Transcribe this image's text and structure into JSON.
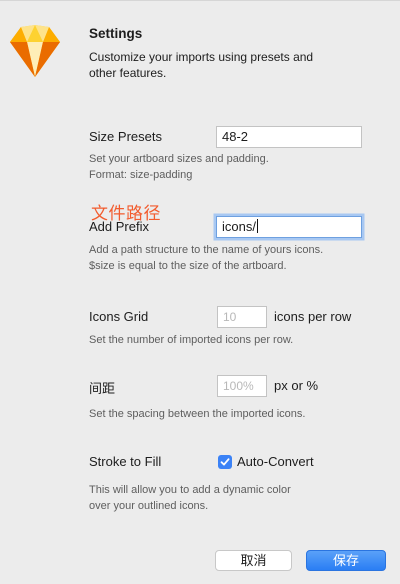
{
  "header": {
    "title": "Settings",
    "subtitle": "Customize your imports using presets and other features."
  },
  "size_presets": {
    "label": "Size Presets",
    "value": "48-2",
    "help": "Set your artboard sizes and padding.\nFormat: size-padding"
  },
  "annotation": "文件路径",
  "add_prefix": {
    "label": "Add Prefix",
    "value": "icons/",
    "help": "Add a path structure to the name of yours icons.\n$size is equal to the size of the artboard."
  },
  "icons_grid": {
    "label": "Icons Grid",
    "placeholder": "10",
    "suffix": "icons per row",
    "help": "Set the number of imported icons per row."
  },
  "spacing": {
    "label": "间距",
    "placeholder": "100%",
    "suffix": "px or %",
    "help": "Set the spacing between the imported icons."
  },
  "stroke_to_fill": {
    "label": "Stroke to Fill",
    "checkbox_label": "Auto-Convert",
    "checked": true,
    "help": "This will allow you to add a dynamic color\nover your outlined icons."
  },
  "buttons": {
    "cancel": "取消",
    "ok": "保存"
  },
  "colors": {
    "accent": "#2a7ef4",
    "annotation": "#f25c2e",
    "logo": "#f7b500"
  },
  "icons": {
    "logo": "sketch-diamond-icon",
    "checkbox": "checkmark-icon"
  }
}
